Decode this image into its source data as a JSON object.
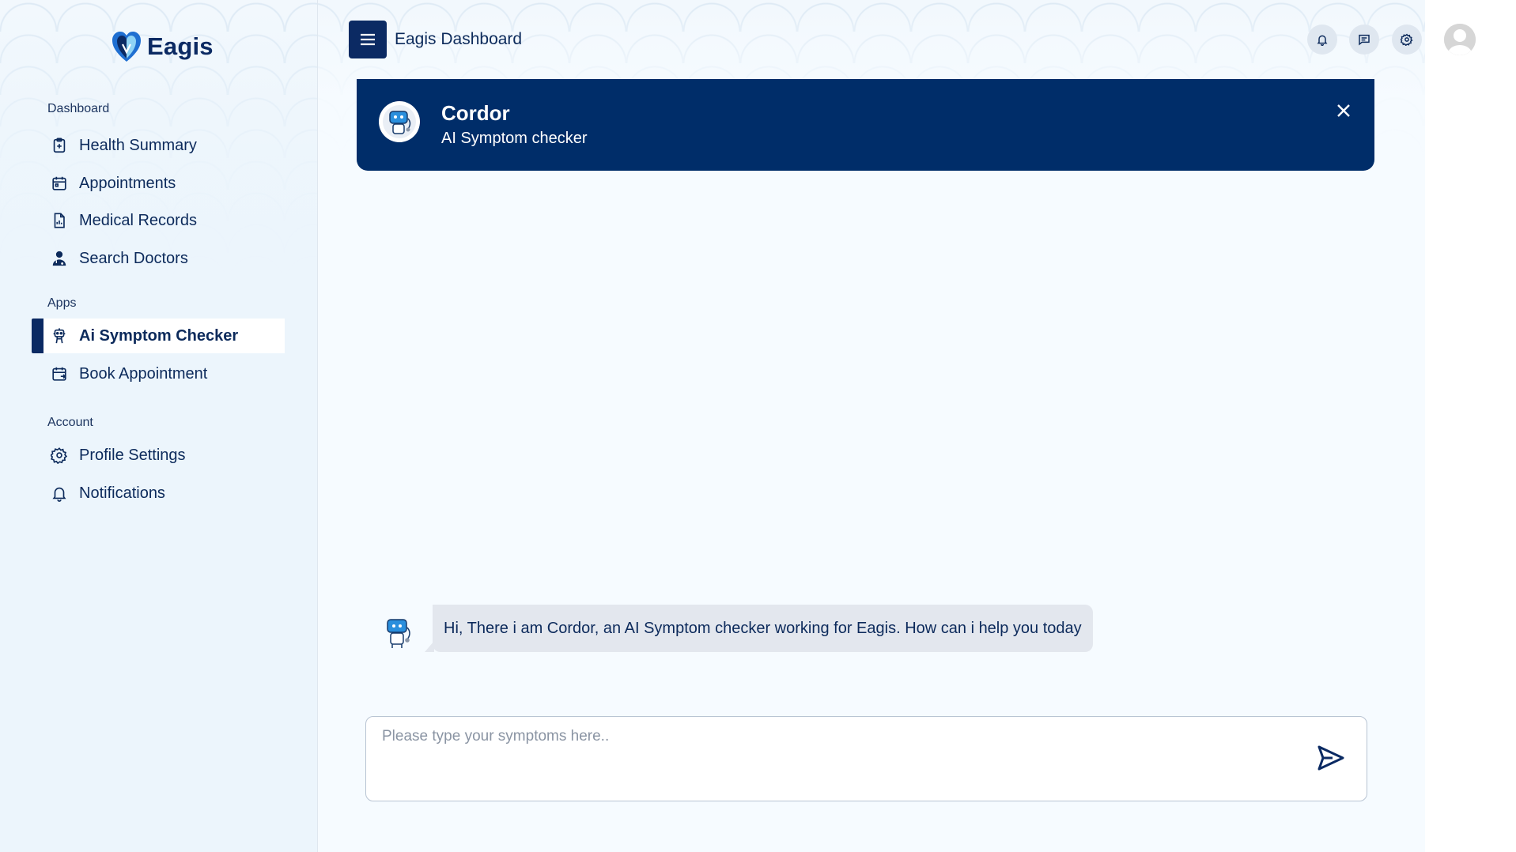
{
  "app": {
    "name": "Eagis"
  },
  "header": {
    "title": "Eagis Dashboard"
  },
  "sidebar": {
    "sections": [
      {
        "label": "Dashboard",
        "items": [
          {
            "label": "Health Summary",
            "icon": "clipboard-icon"
          },
          {
            "label": "Appointments",
            "icon": "calendar-icon"
          },
          {
            "label": "Medical Records",
            "icon": "document-icon"
          },
          {
            "label": "Search Doctors",
            "icon": "doctor-icon"
          }
        ]
      },
      {
        "label": "Apps",
        "items": [
          {
            "label": "Ai Symptom Checker",
            "icon": "robot-icon",
            "active": true
          },
          {
            "label": "Book Appointment",
            "icon": "calendar-book-icon"
          }
        ]
      },
      {
        "label": "Account",
        "items": [
          {
            "label": "Profile Settings",
            "icon": "gear-icon"
          },
          {
            "label": "Notifications",
            "icon": "bell-icon"
          }
        ]
      }
    ]
  },
  "chat": {
    "bot_name": "Cordor",
    "bot_subtitle": "AI Symptom checker",
    "messages": [
      {
        "from": "bot",
        "text": "Hi, There i am Cordor, an AI Symptom checker working for Eagis. How can i help you today"
      }
    ],
    "input": {
      "value": "",
      "placeholder": "Please type your symptoms here.."
    }
  },
  "colors": {
    "primary": "#002d69",
    "accent": "#0b2a63",
    "bubble": "#e3e7ee"
  }
}
